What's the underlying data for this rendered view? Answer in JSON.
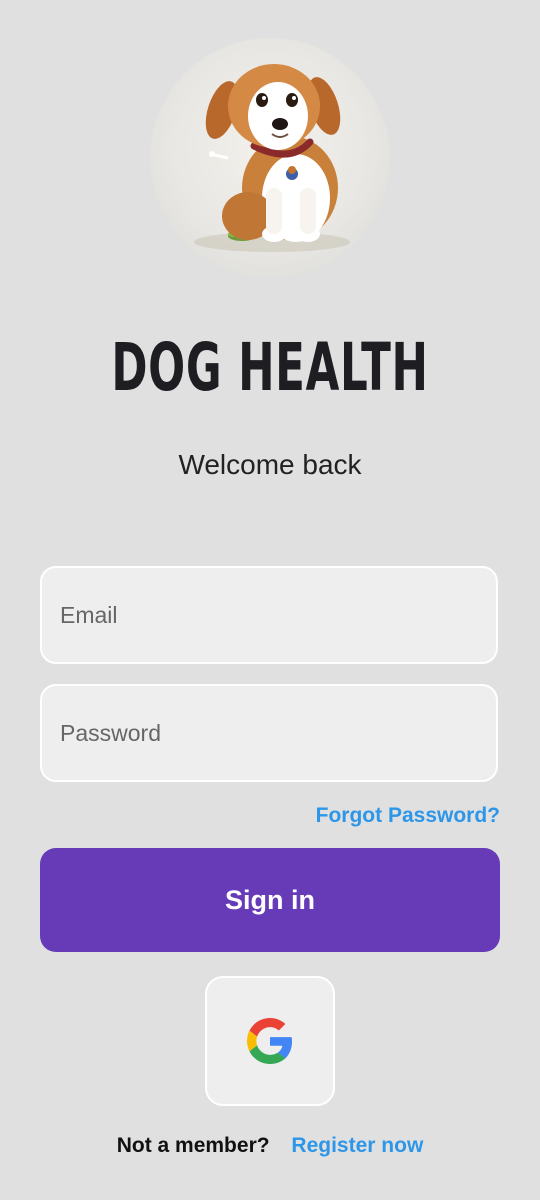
{
  "app": {
    "title": "DOG HEALTH",
    "subtitle": "Welcome back",
    "logo_icon": "puppy-avatar-icon"
  },
  "form": {
    "email_placeholder": "Email",
    "email_value": "",
    "password_placeholder": "Password",
    "password_value": "",
    "forgot_password_label": "Forgot Password?",
    "sign_in_label": "Sign in",
    "google_icon": "google-icon"
  },
  "footer": {
    "not_member_text": "Not a member?",
    "register_label": "Register now"
  },
  "colors": {
    "background": "#e0e0e0",
    "primary": "#673ab7",
    "link": "#2d96e8",
    "title": "#1e1d22"
  }
}
